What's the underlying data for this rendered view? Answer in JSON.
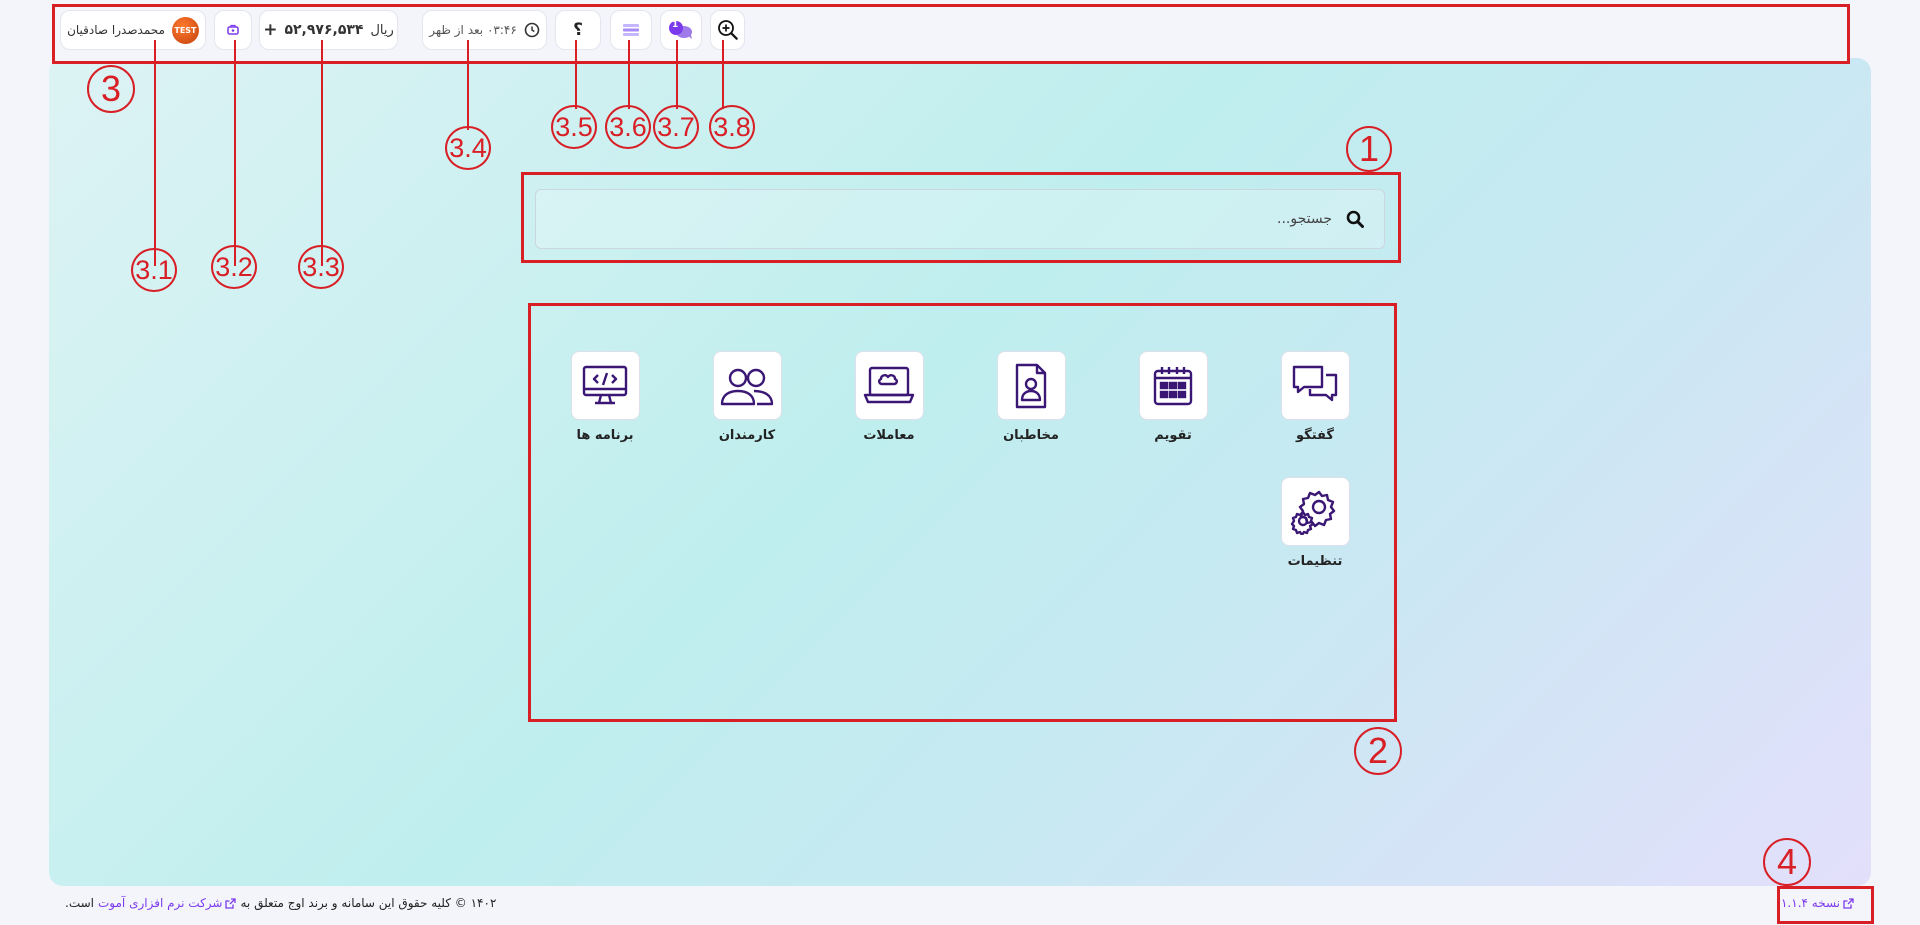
{
  "topbar": {
    "user": {
      "avatar_text": "TEST",
      "name": "محمدصدرا صادقیان"
    },
    "balance": {
      "currency": "ریال",
      "amount": "۵۲,۹۷۶,۵۳۴",
      "add_symbol": "+"
    },
    "time": {
      "label": "۰۳:۴۶ بعد از ظهر"
    },
    "help_symbol": "؟",
    "chat_badge": "1"
  },
  "search": {
    "placeholder": "جستجو..."
  },
  "apps": [
    {
      "label": "گفتگو",
      "icon": "chat-icon"
    },
    {
      "label": "تقویم",
      "icon": "calendar-icon"
    },
    {
      "label": "مخاطبان",
      "icon": "contacts-icon"
    },
    {
      "label": "معاملات",
      "icon": "deals-icon"
    },
    {
      "label": "کارمندان",
      "icon": "employees-icon"
    },
    {
      "label": "برنامه ها",
      "icon": "code-monitor-icon"
    },
    {
      "label": "تنظیمات",
      "icon": "settings-icon"
    }
  ],
  "footer": {
    "copyright_prefix": "۱۴۰۲ © کلیه حقوق این سامانه و برند اوج متعلق به",
    "company_link": "شرکت نرم افزاری آموت",
    "copyright_suffix": "است.",
    "version": "نسخه ۱.۱.۴"
  },
  "annotations": [
    "1",
    "2",
    "3",
    "3.1",
    "3.2",
    "3.3",
    "3.4",
    "3.5",
    "3.6",
    "3.7",
    "3.8",
    "4"
  ],
  "colors": {
    "accent": "#7c3aed",
    "icon": "#3b1775",
    "annotation": "#d81f26",
    "avatar": "#e8590c"
  }
}
